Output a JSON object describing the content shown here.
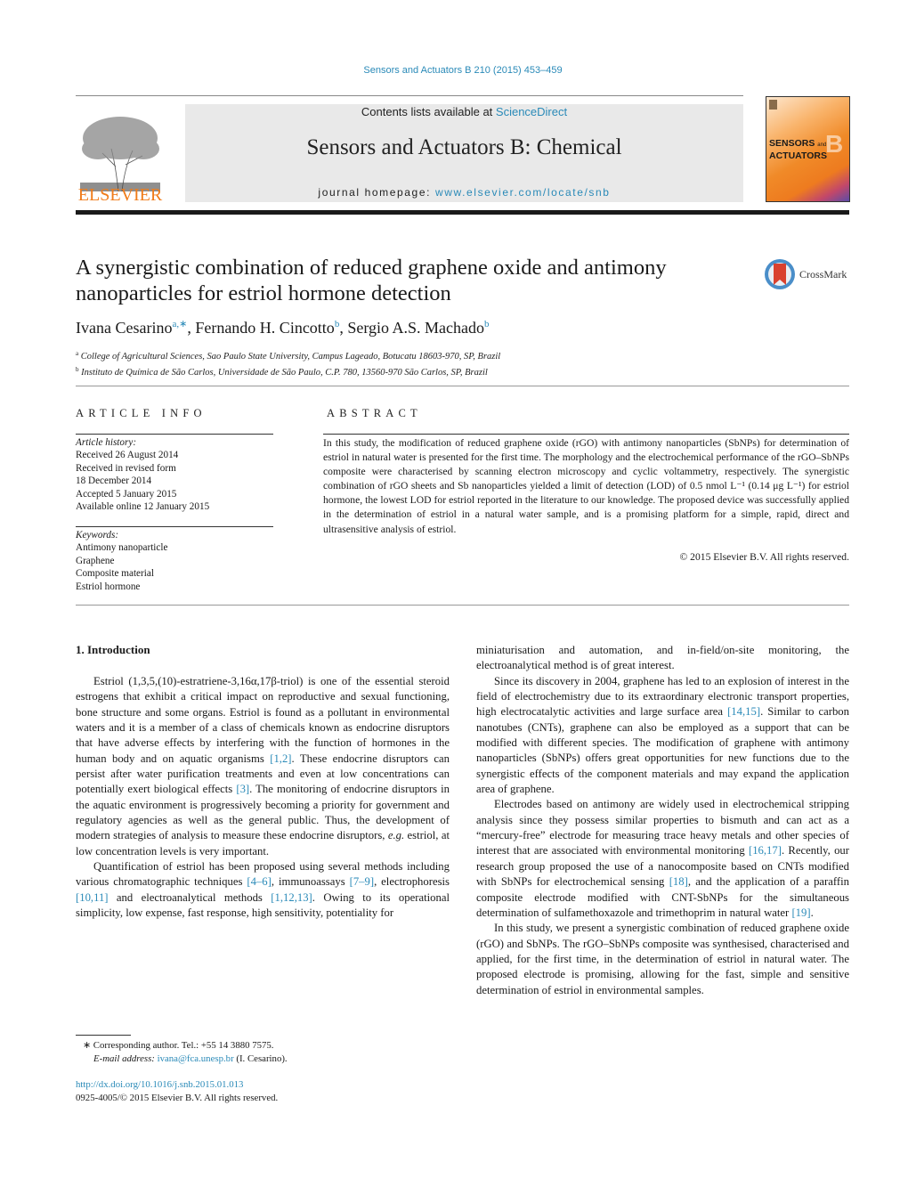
{
  "header": {
    "journal_ref": "Sensors and Actuators B 210 (2015) 453–459",
    "contents_prefix": "Contents lists available at ",
    "contents_link": "ScienceDirect",
    "journal_title": "Sensors and Actuators B: Chemical",
    "homepage_prefix": "journal homepage: ",
    "homepage_link": "www.elsevier.com/locate/snb",
    "publisher_logo_text": "ELSEVIER",
    "cover_line1": "SENSORS",
    "cover_and": "and",
    "cover_line2": "ACTUATORS",
    "cover_letter": "B"
  },
  "article": {
    "title": "A synergistic combination of reduced graphene oxide and antimony nanoparticles for estriol hormone detection",
    "crossmark_label": "CrossMark",
    "authors": [
      {
        "name": "Ivana Cesarino",
        "sup": "a,∗"
      },
      {
        "name": "Fernando H. Cincotto",
        "sup": "b"
      },
      {
        "name": "Sergio A.S. Machado",
        "sup": "b"
      }
    ],
    "affiliations": [
      {
        "sup": "a",
        "text": "College of Agricultural Sciences, Sao Paulo State University, Campus Lageado, Botucatu 18603-970, SP, Brazil"
      },
      {
        "sup": "b",
        "text": "Instituto de Química de São Carlos, Universidade de São Paulo, C.P. 780, 13560-970 São Carlos, SP, Brazil"
      }
    ]
  },
  "article_info": {
    "heading": "ARTICLE INFO",
    "history_label": "Article history:",
    "history": [
      "Received 26 August 2014",
      "Received in revised form",
      "18 December 2014",
      "Accepted 5 January 2015",
      "Available online 12 January 2015"
    ],
    "keywords_label": "Keywords:",
    "keywords": [
      "Antimony nanoparticle",
      "Graphene",
      "Composite material",
      "Estriol hormone"
    ]
  },
  "abstract": {
    "heading": "ABSTRACT",
    "text": "In this study, the modification of reduced graphene oxide (rGO) with antimony nanoparticles (SbNPs) for determination of estriol in natural water is presented for the first time. The morphology and the electrochemical performance of the rGO–SbNPs composite were characterised by scanning electron microscopy and cyclic voltammetry, respectively. The synergistic combination of rGO sheets and Sb nanoparticles yielded a limit of detection (LOD) of 0.5 nmol L⁻¹ (0.14 μg L⁻¹) for estriol hormone, the lowest LOD for estriol reported in the literature to our knowledge. The proposed device was successfully applied in the determination of estriol in a natural water sample, and is a promising platform for a simple, rapid, direct and ultrasensitive analysis of estriol.",
    "copyright": "© 2015 Elsevier B.V. All rights reserved."
  },
  "body": {
    "section_title": "1.  Introduction",
    "left": {
      "p1_a": "Estriol (1,3,5,(10)-estratriene-3,16α,17β-triol) is one of the essential steroid estrogens that exhibit a critical impact on reproductive and sexual functioning, bone structure and some organs. Estriol is found as a pollutant in environmental waters and it is a member of a class of chemicals known as endocrine disruptors that have adverse effects by interfering with the function of hormones in the human body and on aquatic organisms ",
      "p1_ref1": "[1,2]",
      "p1_b": ". These endocrine disruptors can persist after water purification treatments and even at low concentrations can potentially exert biological effects ",
      "p1_ref2": "[3]",
      "p1_c": ". The monitoring of endocrine disruptors in the aquatic environment is progressively becoming a priority for government and regulatory agencies as well as the general public. Thus, the development of modern strategies of analysis to measure these endocrine disruptors, ",
      "p1_eg": "e.g.",
      "p1_d": " estriol, at low concentration levels is very important.",
      "p2_a": "Quantification of estriol has been proposed using several methods including various chromatographic techniques ",
      "p2_ref1": "[4–6]",
      "p2_b": ", immunoassays ",
      "p2_ref2": "[7–9]",
      "p2_c": ", electrophoresis ",
      "p2_ref3": "[10,11]",
      "p2_d": " and electroanalytical methods ",
      "p2_ref4": "[1,12,13]",
      "p2_e": ". Owing to its operational simplicity, low expense, fast response, high sensitivity, potentiality for"
    },
    "right": {
      "p0": "miniaturisation and automation, and in-field/on-site monitoring, the electroanalytical method is of great interest.",
      "p1_a": "Since its discovery in 2004, graphene has led to an explosion of interest in the field of electrochemistry due to its extraordinary electronic transport properties, high electrocatalytic activities and large surface area ",
      "p1_ref": "[14,15]",
      "p1_b": ". Similar to carbon nanotubes (CNTs), graphene can also be employed as a support that can be modified with different species. The modification of graphene with antimony nanoparticles (SbNPs) offers great opportunities for new functions due to the synergistic effects of the component materials and may expand the application area of graphene.",
      "p2_a": "Electrodes based on antimony are widely used in electrochemical stripping analysis since they possess similar properties to bismuth and can act as a “mercury-free” electrode for measuring trace heavy metals and other species of interest that are associated with environmental monitoring ",
      "p2_ref1": "[16,17]",
      "p2_b": ". Recently, our research group proposed the use of a nanocomposite based on CNTs modified with SbNPs for electrochemical sensing ",
      "p2_ref2": "[18]",
      "p2_c": ", and the application of a paraffin composite electrode modified with CNT-SbNPs for the simultaneous determination of sulfamethoxazole and trimethoprim in natural water ",
      "p2_ref3": "[19]",
      "p2_d": ".",
      "p3": "In this study, we present a synergistic combination of reduced graphene oxide (rGO) and SbNPs. The rGO–SbNPs composite was synthesised, characterised and applied, for the first time, in the determination of estriol in natural water. The proposed electrode is promising, allowing for the fast, simple and sensitive determination of estriol in environmental samples."
    }
  },
  "footer": {
    "corresponding": "∗  Corresponding author. Tel.: +55 14 3880 7575.",
    "email_label": "E-mail address: ",
    "email": "ivana@fca.unesp.br",
    "email_suffix": " (I. Cesarino).",
    "doi": "http://dx.doi.org/10.1016/j.snb.2015.01.013",
    "issn": "0925-4005/© 2015 Elsevier B.V. All rights reserved."
  }
}
